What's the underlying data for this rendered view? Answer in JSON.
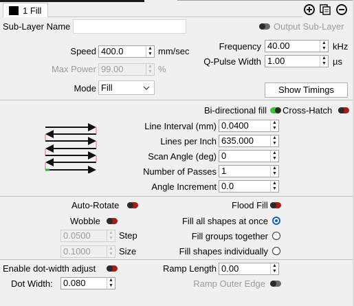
{
  "tab": {
    "label": "1 Fill",
    "swatch_color": "#000000"
  },
  "sublayer": {
    "label": "Sub-Layer Name",
    "value": "",
    "output_label": "Output Sub-Layer"
  },
  "speed": {
    "label": "Speed",
    "value": "400.0",
    "unit": "mm/sec"
  },
  "max_power": {
    "label": "Max Power",
    "value": "99.00",
    "unit": "%"
  },
  "mode": {
    "label": "Mode",
    "value": "Fill"
  },
  "frequency": {
    "label": "Frequency",
    "value": "40.00",
    "unit": "kHz"
  },
  "qpulse": {
    "label": "Q-Pulse Width",
    "value": "1.00",
    "unit": "µs"
  },
  "show_timings": "Show Timings",
  "bidirectional": {
    "label": "Bi-directional fill",
    "on": true
  },
  "crosshatch": {
    "label": "Cross-Hatch",
    "on": false
  },
  "line_interval": {
    "label": "Line Interval (mm)",
    "value": "0.0400"
  },
  "lines_per_inch": {
    "label": "Lines per Inch",
    "value": "635.000"
  },
  "scan_angle": {
    "label": "Scan Angle (deg)",
    "value": "0"
  },
  "passes": {
    "label": "Number of Passes",
    "value": "1"
  },
  "angle_increment": {
    "label": "Angle Increment",
    "value": "0.0"
  },
  "auto_rotate": {
    "label": "Auto-Rotate",
    "on": false
  },
  "flood_fill": {
    "label": "Flood Fill",
    "on": false
  },
  "wobble": {
    "label": "Wobble",
    "on": false
  },
  "wobble_step": {
    "value": "0.0500",
    "label": "Step"
  },
  "wobble_size": {
    "value": "0.1000",
    "label": "Size"
  },
  "fill_options": [
    {
      "label": "Fill all shapes at once",
      "selected": true
    },
    {
      "label": "Fill groups together",
      "selected": false
    },
    {
      "label": "Fill shapes individually",
      "selected": false
    }
  ],
  "dot_width_adjust": {
    "label": "Enable dot-width adjust",
    "on": false
  },
  "dot_width": {
    "label": "Dot Width:",
    "value": "0.080"
  },
  "ramp_length": {
    "label": "Ramp Length",
    "value": "0.00"
  },
  "ramp_outer_edge": {
    "label": "Ramp Outer Edge",
    "on": false
  },
  "colors": {
    "accent": "#0a5fc9",
    "toggle_on": "#3cc43c",
    "toggle_off": "#a31d1d"
  }
}
